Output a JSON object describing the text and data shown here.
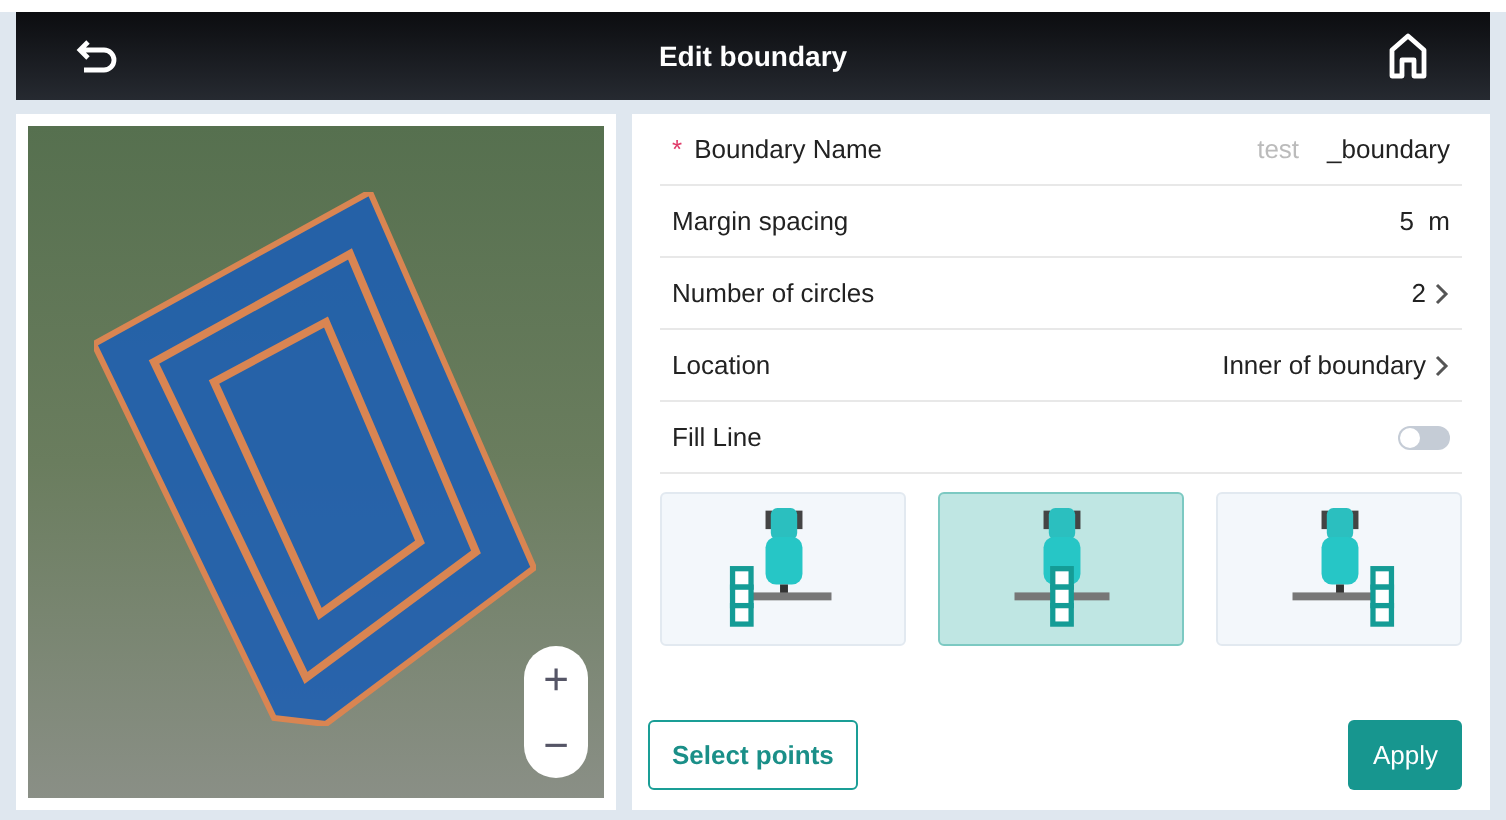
{
  "header": {
    "title": "Edit boundary"
  },
  "map": {
    "zoom_in": "+",
    "zoom_out": "−"
  },
  "form": {
    "name_field": {
      "label": "Boundary Name",
      "required_mark": "*",
      "placeholder": "test",
      "suffix": "_boundary"
    },
    "rows": [
      {
        "kind": "value",
        "label": "Margin spacing",
        "value": "5  m"
      },
      {
        "kind": "select",
        "label": "Number of circles",
        "value": "2"
      },
      {
        "kind": "select",
        "label": "Location",
        "value": "Inner of boundary"
      },
      {
        "kind": "toggle",
        "label": "Fill Line",
        "on": false
      }
    ],
    "modes": [
      {
        "kind": "left",
        "selected": false
      },
      {
        "kind": "center",
        "selected": true
      },
      {
        "kind": "right",
        "selected": false
      }
    ],
    "buttons": [
      {
        "kind": "outline",
        "label": "Select points"
      },
      {
        "kind": "primary",
        "label": "Apply"
      }
    ]
  }
}
